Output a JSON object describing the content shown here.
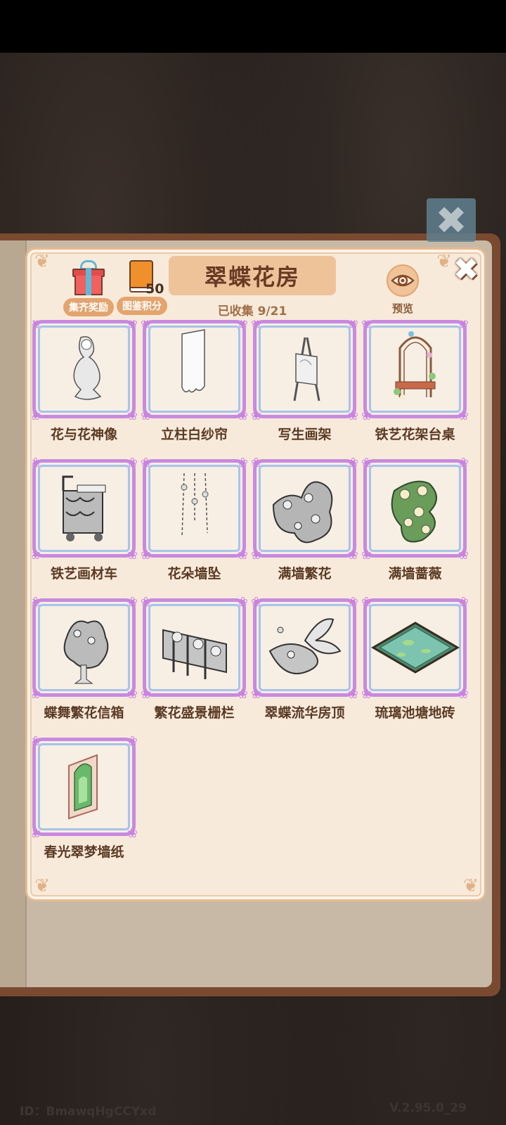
{
  "collection": {
    "title": "翠蝶花房",
    "collected_text": "已收集 9/21"
  },
  "header": {
    "reward_label": "集齐奖励",
    "points_label": "图鉴积分",
    "points_value": "50",
    "preview_label": "预览"
  },
  "items": [
    {
      "name": "花与花神像",
      "icon": "statue-icon",
      "colored": false
    },
    {
      "name": "立柱白纱帘",
      "icon": "curtain-icon",
      "colored": false
    },
    {
      "name": "写生画架",
      "icon": "easel-icon",
      "colored": false
    },
    {
      "name": "铁艺花架台桌",
      "icon": "flower-arch-table-icon",
      "colored": true
    },
    {
      "name": "铁艺画材车",
      "icon": "art-cart-icon",
      "colored": false
    },
    {
      "name": "花朵墙坠",
      "icon": "flower-wall-hanging-icon",
      "colored": false
    },
    {
      "name": "满墙繁花",
      "icon": "wall-flowers-icon",
      "colored": false
    },
    {
      "name": "满墙蔷薇",
      "icon": "wall-roses-icon",
      "colored": true
    },
    {
      "name": "蝶舞繁花信箱",
      "icon": "flower-mailbox-icon",
      "colored": false
    },
    {
      "name": "繁花盛景栅栏",
      "icon": "flower-fence-icon",
      "colored": false
    },
    {
      "name": "翠蝶流华房顶",
      "icon": "butterfly-roof-icon",
      "colored": false
    },
    {
      "name": "琉璃池塘地砖",
      "icon": "pond-tile-icon",
      "colored": true
    },
    {
      "name": "春光翠梦墙纸",
      "icon": "wallpaper-icon",
      "colored": true
    }
  ],
  "footer": {
    "id_text": "ID：BmawqHgCCYxd",
    "version_text": "V.2.95.0_29"
  }
}
